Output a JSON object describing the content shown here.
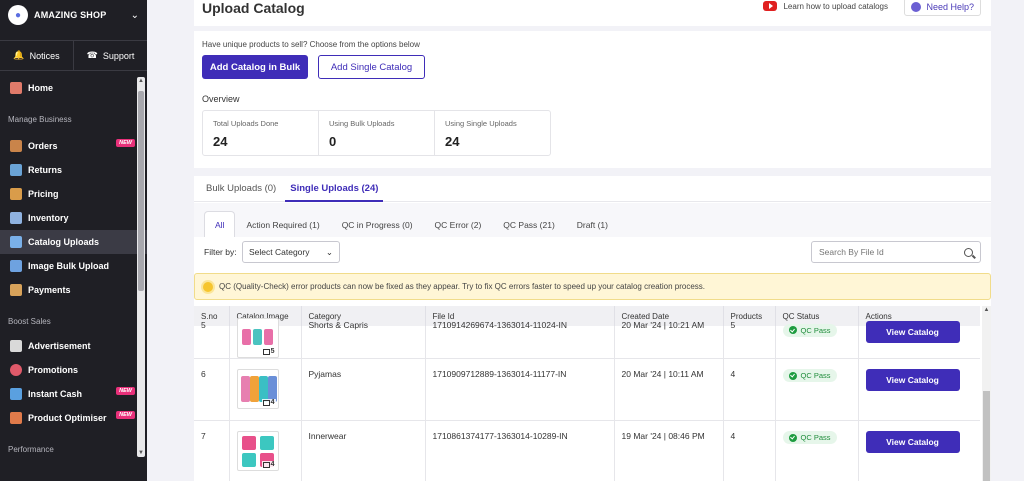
{
  "sidebar": {
    "shop_name": "AMAZING SHOP",
    "notices_label": "Notices",
    "support_label": "Support",
    "home_label": "Home",
    "section_manage": "Manage Business",
    "items": [
      {
        "label": "Orders",
        "badge": "NEW",
        "icon_color": "#c9844a"
      },
      {
        "label": "Returns",
        "badge": "",
        "icon_color": "#6aa3d6"
      },
      {
        "label": "Pricing",
        "badge": "",
        "icon_color": "#d99c4a"
      },
      {
        "label": "Inventory",
        "badge": "",
        "icon_color": "#8fb2e0"
      },
      {
        "label": "Catalog Uploads",
        "badge": "",
        "icon_color": "#7ab0e8"
      },
      {
        "label": "Image Bulk Upload",
        "badge": "",
        "icon_color": "#6ea2e0"
      },
      {
        "label": "Payments",
        "badge": "",
        "icon_color": "#d8a25a"
      }
    ],
    "section_boost": "Boost Sales",
    "boost_items": [
      {
        "label": "Advertisement",
        "badge": "",
        "icon_color": "#d9d9d9"
      },
      {
        "label": "Promotions",
        "badge": "",
        "icon_color": "#e05a6a"
      },
      {
        "label": "Instant Cash",
        "badge": "NEW",
        "icon_color": "#5aa0e0"
      },
      {
        "label": "Product Optimiser",
        "badge": "NEW",
        "icon_color": "#e07a4a"
      }
    ],
    "section_performance": "Performance"
  },
  "header": {
    "title": "Upload Catalog",
    "learn_text": "Learn how to upload catalogs",
    "help_text": "Need Help?"
  },
  "upload": {
    "intro": "Have unique products to sell? Choose from the options below",
    "bulk_button": "Add Catalog in Bulk",
    "single_button": "Add Single Catalog",
    "overview_label": "Overview",
    "stats": [
      {
        "label": "Total Uploads Done",
        "value": "24"
      },
      {
        "label": "Using Bulk Uploads",
        "value": "0"
      },
      {
        "label": "Using Single Uploads",
        "value": "24"
      }
    ]
  },
  "tabs": {
    "main": [
      "Bulk Uploads (0)",
      "Single Uploads (24)"
    ],
    "sub": [
      "All",
      "Action Required (1)",
      "QC in Progress (0)",
      "QC Error (2)",
      "QC Pass (21)",
      "Draft (1)"
    ]
  },
  "filter": {
    "label": "Filter by:",
    "select_value": "Select Category",
    "search_placeholder": "Search By File Id"
  },
  "banner": {
    "text": "QC (Quality-Check) error products can now be fixed as they appear. Try to fix QC errors faster to speed up your catalog creation process."
  },
  "table": {
    "headers": [
      "S.no",
      "Catalog Image",
      "Category",
      "File Id",
      "Created Date",
      "Products",
      "QC Status",
      "Actions"
    ],
    "partial_row": {
      "sno": "5",
      "category": "Shorts & Capris",
      "file_id": "1710914269674-1363014-11024-IN",
      "date": "20 Mar '24 | 10:21 AM",
      "products": "5",
      "status": "QC Pass",
      "action": "View Catalog",
      "image_count": "5"
    },
    "rows": [
      {
        "sno": "6",
        "category": "Pyjamas",
        "file_id": "1710909712889-1363014-11177-IN",
        "date": "20 Mar '24 | 10:11 AM",
        "products": "4",
        "status": "QC Pass",
        "action": "View Catalog",
        "image_count": "4"
      },
      {
        "sno": "7",
        "category": "Innerwear",
        "file_id": "1710861374177-1363014-10289-IN",
        "date": "19 Mar '24 | 08:46 PM",
        "products": "4",
        "status": "QC Pass",
        "action": "View Catalog",
        "image_count": "4"
      }
    ]
  }
}
